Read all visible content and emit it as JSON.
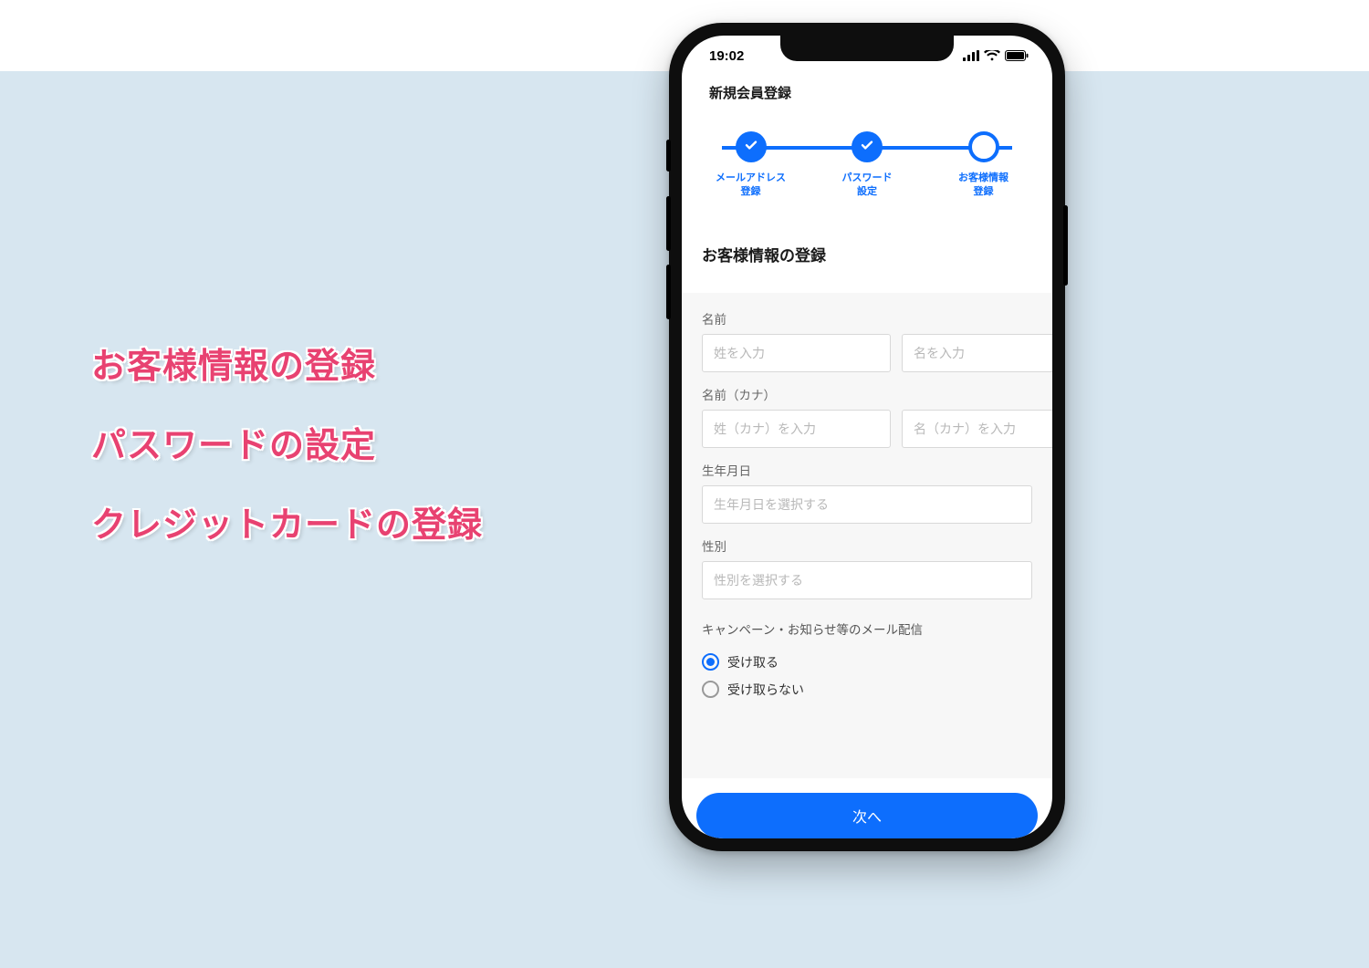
{
  "slide": {
    "lines": [
      "お客様情報の登録",
      "パスワードの設定",
      "クレジットカードの登録"
    ]
  },
  "statusBar": {
    "time": "19:02"
  },
  "nav": {
    "title": "新規会員登録"
  },
  "stepper": {
    "steps": [
      {
        "label_line1": "メールアドレス",
        "label_line2": "登録",
        "state": "done"
      },
      {
        "label_line1": "パスワード",
        "label_line2": "設定",
        "state": "done"
      },
      {
        "label_line1": "お客様情報",
        "label_line2": "登録",
        "state": "active"
      }
    ]
  },
  "section": {
    "title": "お客様情報の登録"
  },
  "form": {
    "name": {
      "label": "名前",
      "last_placeholder": "姓を入力",
      "first_placeholder": "名を入力"
    },
    "kana": {
      "label": "名前（カナ）",
      "last_placeholder": "姓（カナ）を入力",
      "first_placeholder": "名（カナ）を入力"
    },
    "birth": {
      "label": "生年月日",
      "placeholder": "生年月日を選択する"
    },
    "gender": {
      "label": "性別",
      "placeholder": "性別を選択する"
    },
    "mail": {
      "label": "キャンペーン・お知らせ等のメール配信",
      "opt_in": "受け取る",
      "opt_out": "受け取らない",
      "selected": "opt_in"
    }
  },
  "cta": {
    "label": "次へ"
  },
  "colors": {
    "accent": "#0d6efd",
    "slide_text": "#e84271",
    "bg_panel": "#d7e6f0"
  }
}
